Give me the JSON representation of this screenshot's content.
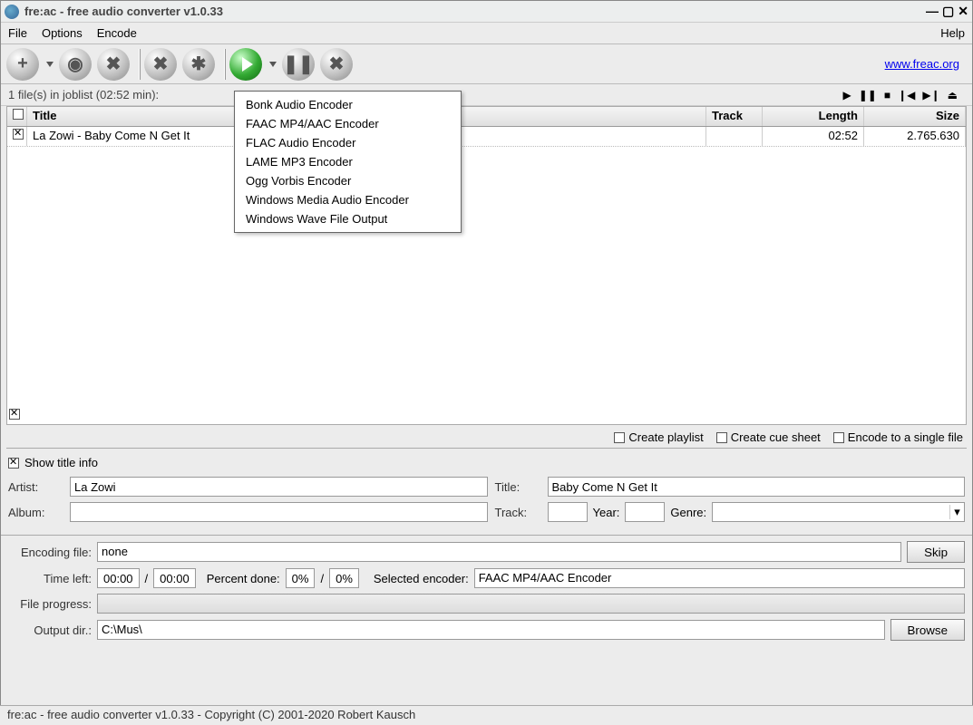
{
  "titlebar": {
    "title": "fre:ac - free audio converter v1.0.33"
  },
  "menubar": {
    "file": "File",
    "options": "Options",
    "encode": "Encode",
    "help": "Help"
  },
  "toolbar": {
    "link": "www.freac.org"
  },
  "joblist": {
    "count_text": "1 file(s) in joblist (02:52 min):",
    "headers": {
      "title": "Title",
      "track": "Track",
      "length": "Length",
      "size": "Size"
    },
    "rows": [
      {
        "checked": true,
        "title": "La Zowi - Baby Come N Get It",
        "track": "",
        "length": "02:52",
        "size": "2.765.630"
      }
    ]
  },
  "encoder_menu": [
    "Bonk Audio Encoder",
    "FAAC MP4/AAC Encoder",
    "FLAC Audio Encoder",
    "LAME MP3 Encoder",
    "Ogg Vorbis Encoder",
    "Windows Media Audio Encoder",
    "Windows Wave File Output"
  ],
  "options": {
    "create_playlist": "Create playlist",
    "create_cue_sheet": "Create cue sheet",
    "encode_single": "Encode to a single file"
  },
  "title_info": {
    "show_label": "Show title info",
    "labels": {
      "artist": "Artist:",
      "title": "Title:",
      "album": "Album:",
      "track": "Track:",
      "year": "Year:",
      "genre": "Genre:"
    },
    "artist": "La Zowi",
    "title": "Baby Come N Get It",
    "album": "",
    "track": "",
    "year": "",
    "genre": ""
  },
  "encoding": {
    "labels": {
      "encoding_file": "Encoding file:",
      "time_left": "Time left:",
      "percent_done": "Percent done:",
      "selected_encoder": "Selected encoder:",
      "file_progress": "File progress:",
      "output_dir": "Output dir.:"
    },
    "encoding_file": "none",
    "time_left_1": "00:00",
    "time_left_2": "00:00",
    "percent_1": "0%",
    "percent_2": "0%",
    "selected_encoder": "FAAC MP4/AAC Encoder",
    "output_dir": "C:\\Mus\\",
    "skip": "Skip",
    "browse": "Browse"
  },
  "statusbar": "fre:ac - free audio converter v1.0.33 - Copyright (C) 2001-2020 Robert Kausch"
}
